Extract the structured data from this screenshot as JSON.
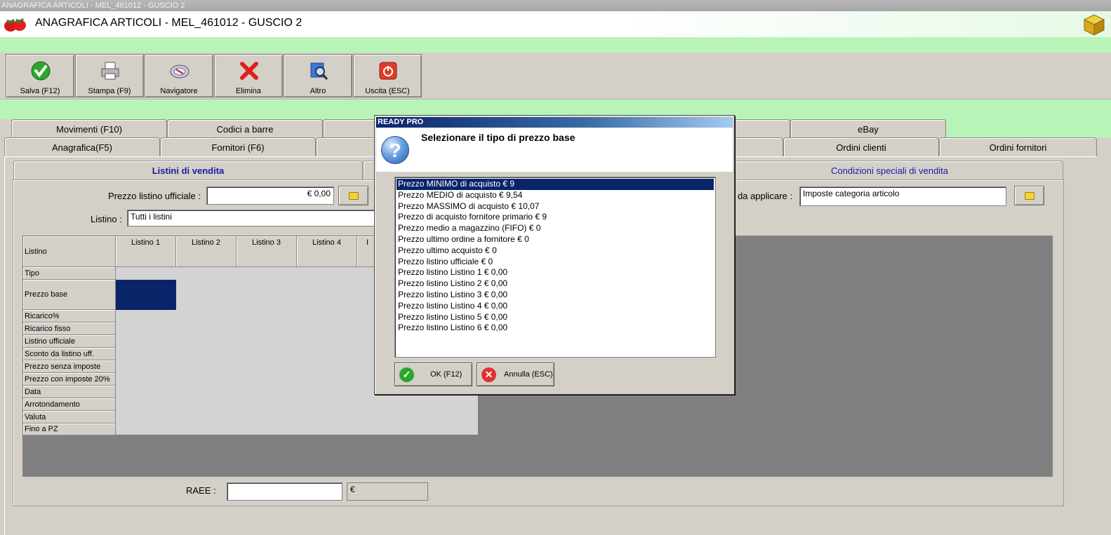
{
  "window": {
    "title": "ANAGRAFICA ARTICOLI - MEL_461012 - GUSCIO 2"
  },
  "header": {
    "title": "ANAGRAFICA ARTICOLI - MEL_461012 - GUSCIO 2"
  },
  "toolbar": {
    "save": "Salva (F12)",
    "print": "Stampa (F9)",
    "navigator": "Navigatore",
    "delete": "Elimina",
    "other": "Altro",
    "exit": "Uscita (ESC)"
  },
  "tabs_top": {
    "movimenti": "Movimenti (F10)",
    "codici": "Codici a barre",
    "ebay": "eBay"
  },
  "tabs_bottom": {
    "anagrafica": "Anagrafica(F5)",
    "fornitori": "Fornitori (F6)",
    "ordini_clienti": "Ordini clienti",
    "ordini_fornitori": "Ordini fornitori"
  },
  "inner_tabs": {
    "listini": "Listini di vendita",
    "condizioni": "Condizioni speciali di vendita"
  },
  "form": {
    "prezzo_listino_label": "Prezzo listino ufficiale :",
    "prezzo_listino_value": "€ 0,00",
    "listino_label": "Listino :",
    "listino_value": "Tutti i listini",
    "imposte_label": "da applicare :",
    "imposte_value": "Imposte categoria articolo",
    "raee_label": "RAEE :",
    "raee_value": "",
    "raee_currency": "€"
  },
  "grid": {
    "corner": "Listino",
    "columns": [
      "Listino 1",
      "Listino 2",
      "Listino 3",
      "Listino 4",
      "I"
    ],
    "rows": [
      "Tipo",
      "Prezzo base",
      "Ricarico%",
      "Ricarico fisso",
      "Listino ufficiale",
      "Sconto da listino uff.",
      "Prezzo senza imposte",
      "Prezzo con imposte 20%",
      "Data",
      "Arrotondamento",
      "Valuta",
      "Fino a PZ"
    ]
  },
  "dialog": {
    "title": "READY PRO",
    "message": "Selezionare il tipo di prezzo base",
    "options": [
      "Prezzo MINIMO di acquisto € 9",
      "Prezzo MEDIO di acquisto € 9,54",
      "Prezzo MASSIMO di acquisto € 10,07",
      "Prezzo di acquisto fornitore primario € 9",
      "Prezzo medio a magazzino (FIFO) € 0",
      "Prezzo ultimo ordine a fornitore € 0",
      "Prezzo ultimo acquisto € 0",
      "Prezzo listino ufficiale € 0",
      "Prezzo listino Listino 1 € 0,00",
      "Prezzo listino Listino 2 € 0,00",
      "Prezzo listino Listino 3 € 0,00",
      "Prezzo listino Listino 4 € 0,00",
      "Prezzo listino Listino 5 € 0,00",
      "Prezzo listino Listino 6 € 0,00"
    ],
    "selected_index": 0,
    "ok": "OK (F12)",
    "cancel": "Annulla (ESC)"
  },
  "colors": {
    "accent_green": "#b8f4b8",
    "selection": "#0a246a",
    "title_blue": "#0a246a"
  }
}
